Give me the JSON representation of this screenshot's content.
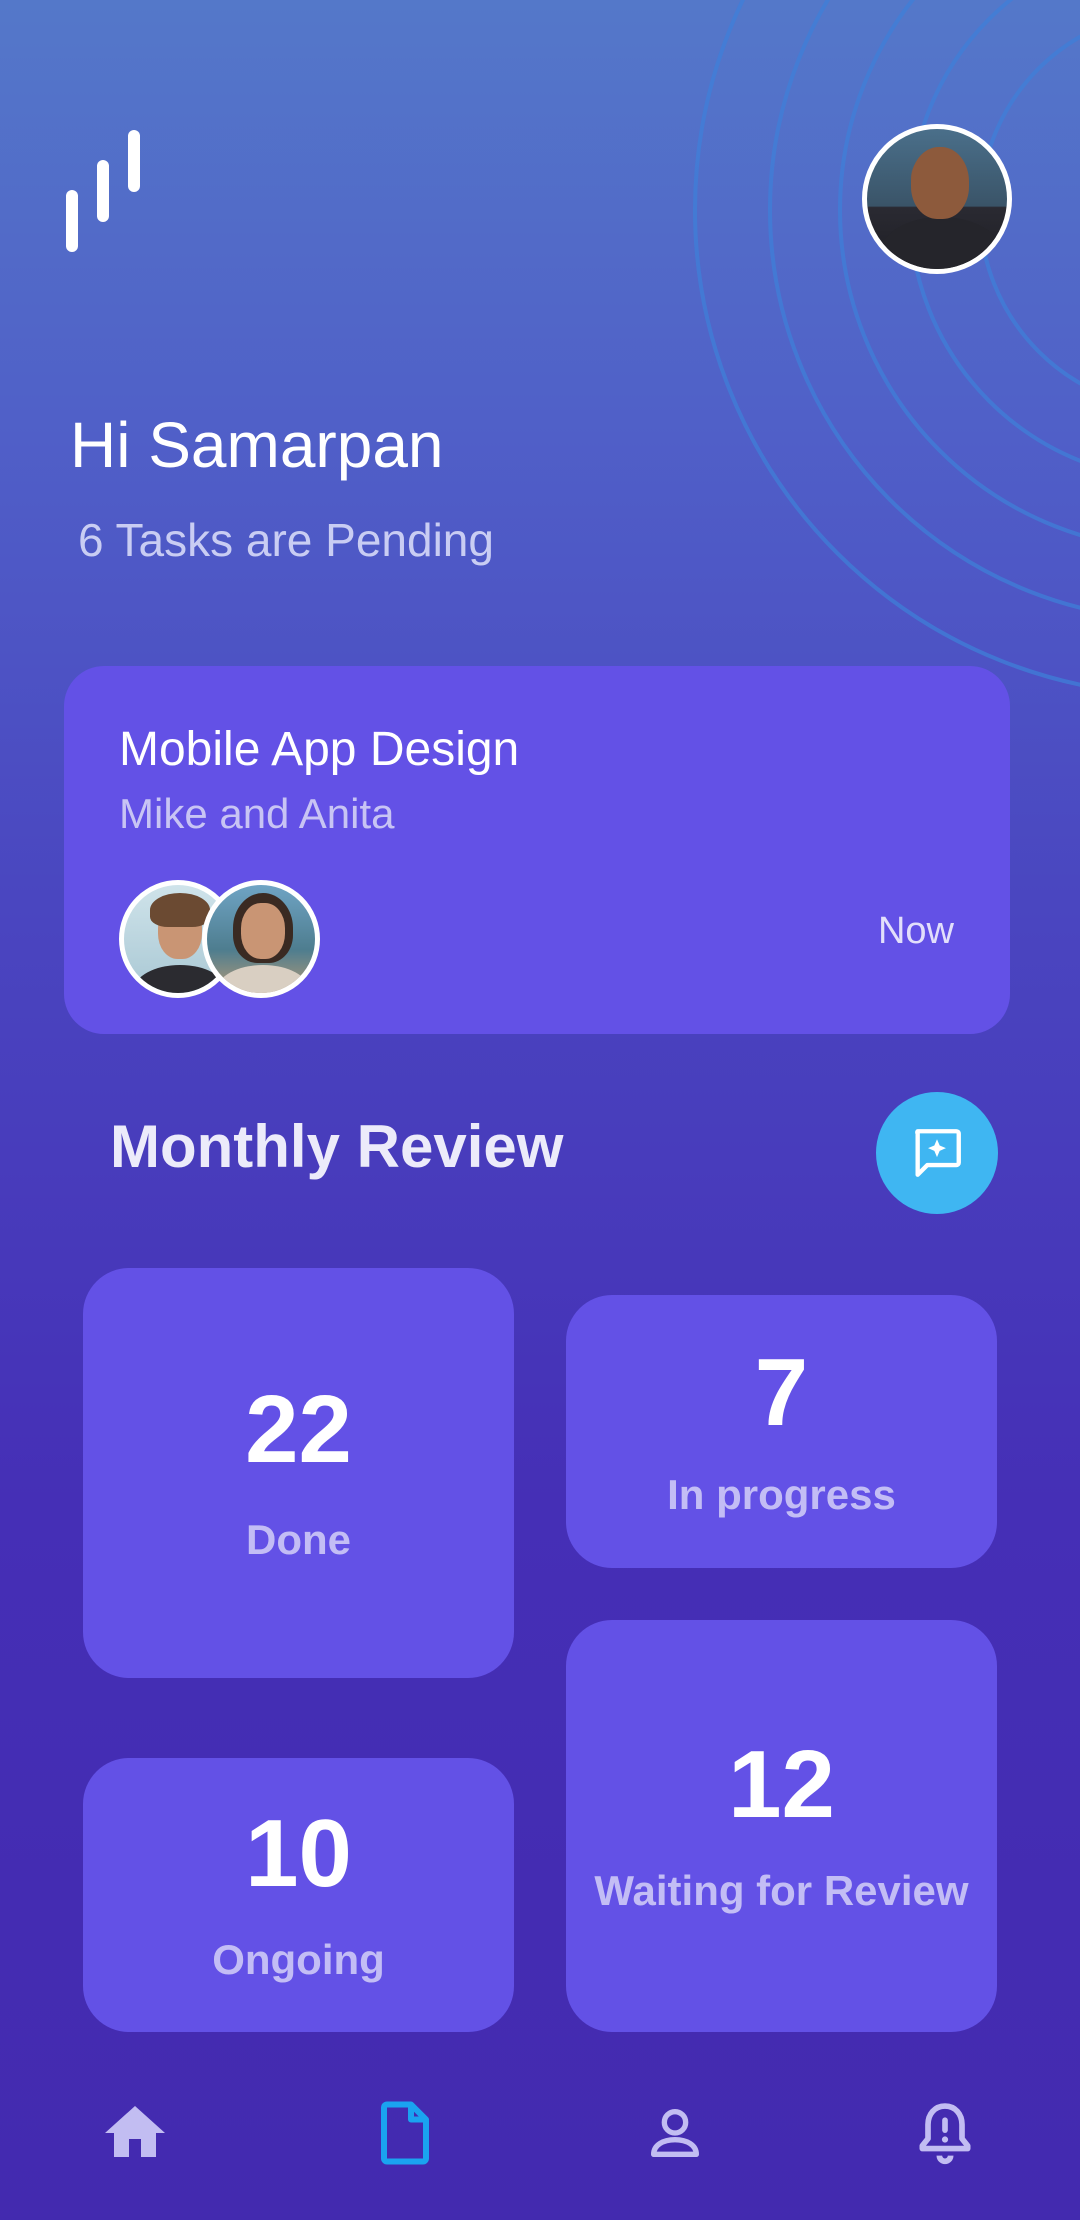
{
  "header": {
    "greeting": "Hi Samarpan",
    "subtitle": "6 Tasks are Pending"
  },
  "current_task": {
    "title": "Mobile App Design",
    "members": "Mike and Anita",
    "time": "Now"
  },
  "review": {
    "title": "Monthly Review",
    "stats": [
      {
        "value": "22",
        "label": "Done"
      },
      {
        "value": "7",
        "label": "In progress"
      },
      {
        "value": "10",
        "label": "Ongoing"
      },
      {
        "value": "12",
        "label": "Waiting for Review"
      }
    ]
  },
  "nav": {
    "active": "documents",
    "items": [
      "home-icon",
      "document-icon",
      "profile-icon",
      "bell-icon"
    ]
  },
  "colors": {
    "card": "#6351e6",
    "accent": "#3fb6f2",
    "active_nav": "#1aa3f0",
    "inactive_nav": "#c2bdf2"
  }
}
